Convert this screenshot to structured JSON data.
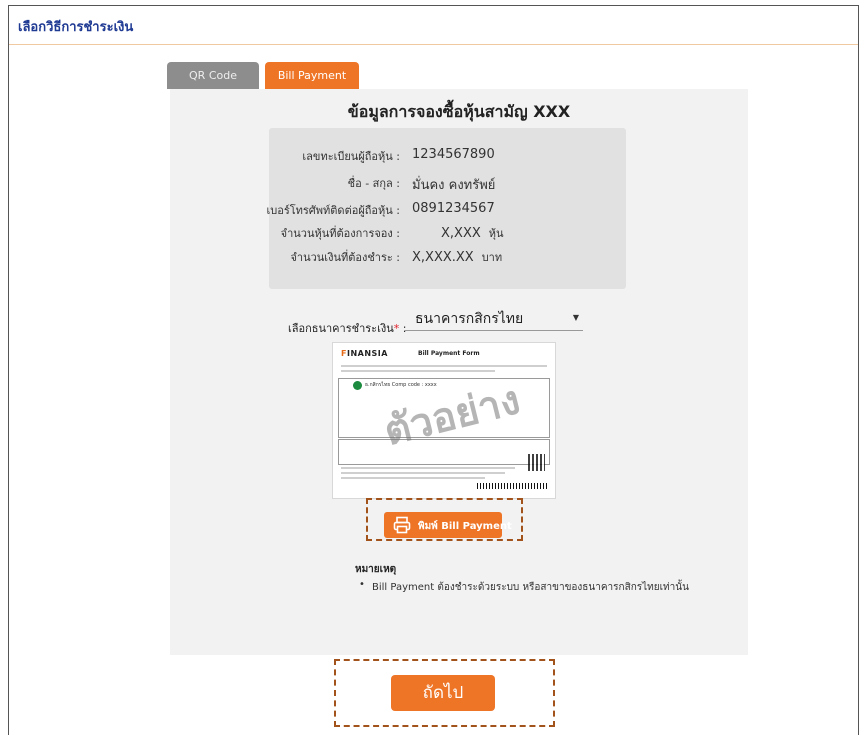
{
  "section": {
    "title": "เลือกวิธีการชำระเงิน"
  },
  "tabs": [
    {
      "label": "QR Code",
      "active": false
    },
    {
      "label": "Bill Payment",
      "active": true
    }
  ],
  "details": {
    "heading": "ข้อมูลการจองซื้อหุ้นสามัญ XXX",
    "rows": [
      {
        "label": "เลขทะเบียนผู้ถือหุ้น :",
        "value": "1234567890",
        "unit": ""
      },
      {
        "label": "ชื่อ - สกุล :",
        "value": "มั่นคง คงทรัพย์",
        "unit": ""
      },
      {
        "label": "เบอร์โทรศัพท์ติดต่อผู้ถือหุ้น :",
        "value": "0891234567",
        "unit": ""
      },
      {
        "label": "จำนวนหุ้นที่ต้องการจอง :",
        "value": "X,XXX",
        "unit": "หุ้น"
      },
      {
        "label": "จำนวนเงินที่ต้องชำระ :",
        "value": "X,XXX.XX",
        "unit": "บาท"
      }
    ]
  },
  "bank": {
    "label": "เลือกธนาคารชำระเงิน",
    "required_mark": "*",
    "colon": ":",
    "selected": "ธนาคารกสิกรไทย"
  },
  "preview": {
    "logo_mark": "F",
    "logo_rest": "INANSIA",
    "form_title": "Bill Payment Form",
    "bank_text": "ธ.กสิกรไทย  Comp code : xxxx",
    "watermark": "ตัวอย่าง"
  },
  "print": {
    "label": "พิมพ์ Bill Payment",
    "icon": "printer-icon"
  },
  "note": {
    "title": "หมายเหตุ",
    "items": [
      "Bill Payment ต้องชำระด้วยระบบ หรือสาขาของธนาคารกสิกรไทยเท่านั้น"
    ]
  },
  "next": {
    "label": "ถัดไป"
  },
  "colors": {
    "accent": "#ee7426",
    "title_blue": "#1f3a93",
    "tab_inactive": "#8d8d8d",
    "highlight_dash": "#a2531b"
  }
}
